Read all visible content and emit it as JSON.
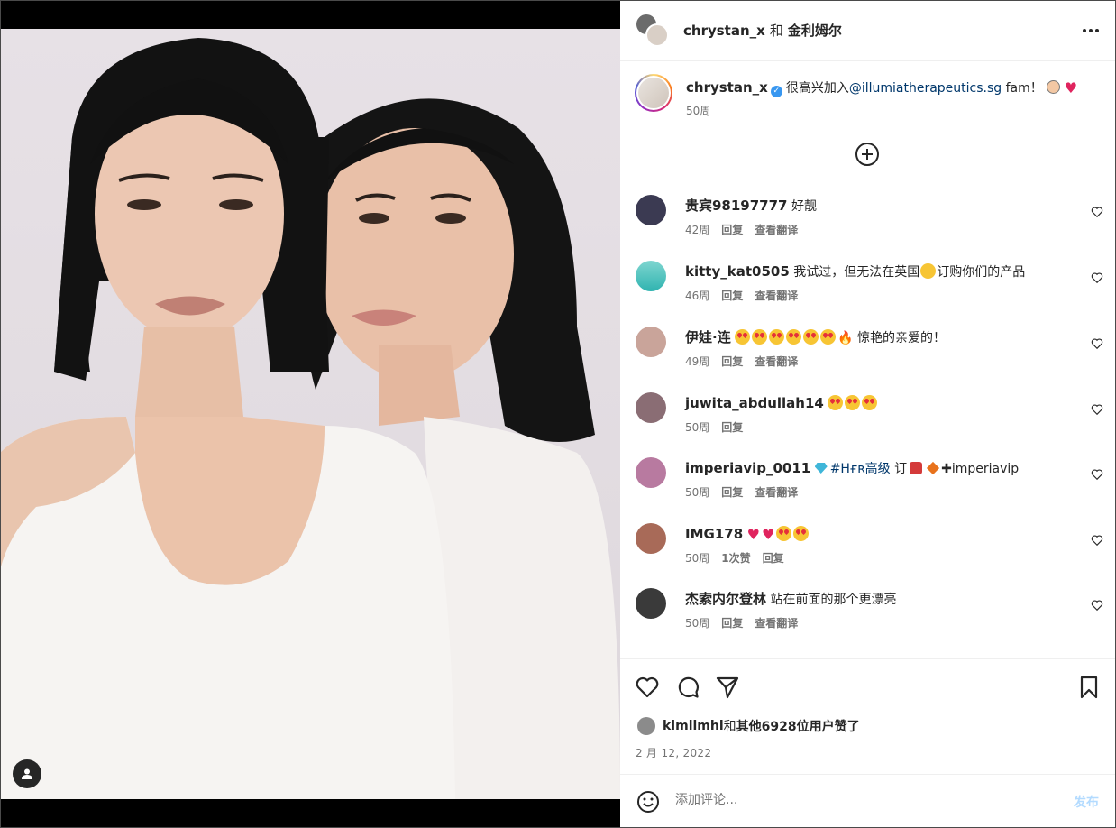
{
  "header": {
    "user1": "chrystan_x",
    "and": "和",
    "user2": "金利姆尔",
    "more_icon": "more-horizontal-icon"
  },
  "caption": {
    "username": "chrystan_x",
    "text_before": "很高兴加入",
    "mention": "@illumiatherapeutics.sg",
    "text_after": " fam！",
    "time": "50周"
  },
  "comments": [
    {
      "user": "贵宾98197777",
      "text": "好靓",
      "time": "42周",
      "likes": "",
      "reply": "回复",
      "translate": "查看翻译",
      "avatar_color": "#3b3a52"
    },
    {
      "user": "kitty_kat0505",
      "text": "我试过，但无法在英国",
      "text2": "订购你们的产品",
      "time": "46周",
      "likes": "",
      "reply": "回复",
      "translate": "查看翻译",
      "avatar_color": "#2fb3b0"
    },
    {
      "user": "伊娃·连",
      "text": "惊艳的亲爱的！",
      "time": "49周",
      "likes": "",
      "reply": "回复",
      "translate": "查看翻译",
      "avatar_color": "#c9a49a"
    },
    {
      "user": "juwita_abdullah14",
      "text": "",
      "time": "50周",
      "likes": "",
      "reply": "回复",
      "translate": "",
      "avatar_color": "#8a6d74"
    },
    {
      "user": "imperiavip_0011",
      "text": "#Hғʀ高级",
      "text2": "订",
      "text3": "imperiavip",
      "time": "50周",
      "likes": "",
      "reply": "回复",
      "translate": "查看翻译",
      "avatar_color": "#b87aa0"
    },
    {
      "user": "IMG178",
      "text": "",
      "time": "50周",
      "likes": "1次赞",
      "reply": "回复",
      "translate": "",
      "avatar_color": "#a86a58"
    },
    {
      "user": "杰索内尔登林",
      "text": "站在前面的那个更漂亮",
      "time": "50周",
      "likes": "",
      "reply": "回复",
      "translate": "查看翻译",
      "avatar_color": "#3a3a3a"
    }
  ],
  "likes": {
    "user": "kimlimhl",
    "and": "和",
    "others": "其他6928位用户",
    "suffix": "赞了"
  },
  "date": "2 月 12, 2022",
  "comment_input": {
    "placeholder": "添加评论...",
    "publish": "发布"
  },
  "colors": {
    "link": "#00376b",
    "muted": "#737373",
    "publish_disabled": "#b3dbff",
    "verified": "#3897f0"
  }
}
